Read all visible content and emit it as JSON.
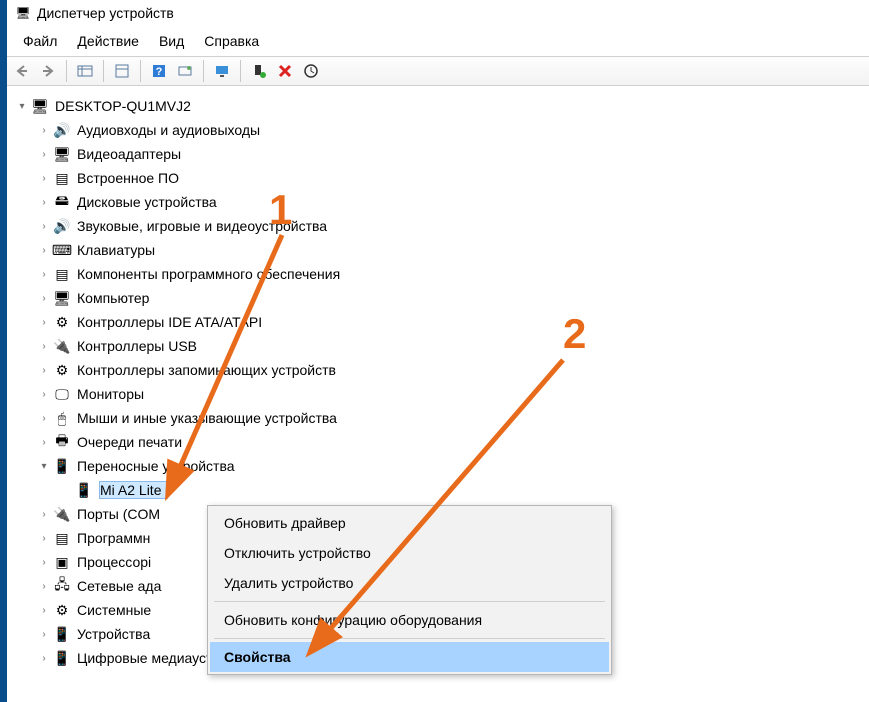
{
  "window": {
    "title": "Диспетчер устройств"
  },
  "menu": {
    "file": "Файл",
    "action": "Действие",
    "view": "Вид",
    "help": "Справка"
  },
  "tree": {
    "root": "DESKTOP-QU1MVJ2",
    "items": [
      {
        "label": "Аудиовходы и аудиовыходы",
        "icon": "🔊"
      },
      {
        "label": "Видеоадаптеры",
        "icon": "🖥"
      },
      {
        "label": "Встроенное ПО",
        "icon": "▤"
      },
      {
        "label": "Дисковые устройства",
        "icon": "🖴"
      },
      {
        "label": "Звуковые, игровые и видеоустройства",
        "icon": "🔊"
      },
      {
        "label": "Клавиатуры",
        "icon": "⌨"
      },
      {
        "label": "Компоненты программного обеспечения",
        "icon": "▤"
      },
      {
        "label": "Компьютер",
        "icon": "🖥"
      },
      {
        "label": "Контроллеры IDE ATA/ATAPI",
        "icon": "⚙"
      },
      {
        "label": "Контроллеры USB",
        "icon": "🔌"
      },
      {
        "label": "Контроллеры запоминающих устройств",
        "icon": "⚙"
      },
      {
        "label": "Мониторы",
        "icon": "🖵"
      },
      {
        "label": "Мыши и иные указывающие устройства",
        "icon": "🖱"
      },
      {
        "label": "Очереди печати",
        "icon": "🖶"
      },
      {
        "label": "Переносные устройства",
        "icon": "📱",
        "expanded": true,
        "child": "Mi A2 Lite"
      },
      {
        "label": "Порты (COM",
        "icon": "🔌"
      },
      {
        "label": "Программн",
        "icon": "▤"
      },
      {
        "label": "Процессорі",
        "icon": "▣"
      },
      {
        "label": "Сетевые ада",
        "icon": "🖧"
      },
      {
        "label": "Системные",
        "icon": "⚙"
      },
      {
        "label": "Устройства",
        "icon": "📱"
      },
      {
        "label": "Цифровые медиаустройства",
        "icon": "📱"
      }
    ]
  },
  "context_menu": {
    "update_driver": "Обновить драйвер",
    "disable_device": "Отключить устройство",
    "uninstall_device": "Удалить устройство",
    "scan_hardware": "Обновить конфигурацию оборудования",
    "properties": "Свойства"
  },
  "annotations": {
    "one": "1",
    "two": "2"
  }
}
